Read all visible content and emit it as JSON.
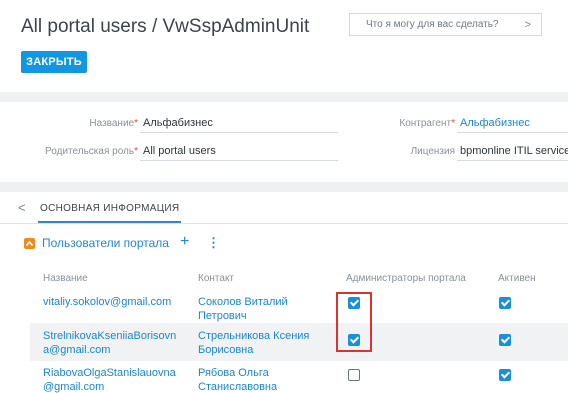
{
  "header": {
    "title": "All portal users / VwSspAdminUnit",
    "search_placeholder": "Что я могу для вас сделать?",
    "close_button": "ЗАКРЫТЬ"
  },
  "fields": {
    "name_label": "Название",
    "name_value": "Альфабизнес",
    "parent_role_label": "Родительская роль",
    "parent_role_value": "All portal users",
    "account_label": "Контрагент",
    "account_value": "Альфабизнес",
    "license_label": "Лицензия",
    "license_value": "bpmonline ITIL service"
  },
  "tabs": {
    "active": "ОСНОВНАЯ ИНФОРМАЦИЯ"
  },
  "detail": {
    "title": "Пользователи портала",
    "columns": [
      "Название",
      "Контакт",
      "Администраторы портала",
      "Активен"
    ],
    "rows": [
      {
        "name_1": "vitaliy.sokolov@gmail.com",
        "name_2": "",
        "contact_1": "Соколов Виталий",
        "contact_2": "Петрович",
        "admin": true,
        "active": true
      },
      {
        "name_1": "StrelnikovaKseniiaBorisovn",
        "name_2": "a@gmail.com",
        "contact_1": "Стрельникова Ксения",
        "contact_2": "Борисовна",
        "admin": true,
        "active": true
      },
      {
        "name_1": "RiabovaOlgaStanislauovna",
        "name_2": "@gmail.com",
        "contact_1": "Рябова Ольга",
        "contact_2": "Станиславовна",
        "admin": false,
        "active": true
      }
    ]
  },
  "colors": {
    "accent": "#1196e2",
    "link": "#1a86d0",
    "required": "#e2472a",
    "detail_toggle": "#f2891f",
    "highlight": "#e03030"
  }
}
